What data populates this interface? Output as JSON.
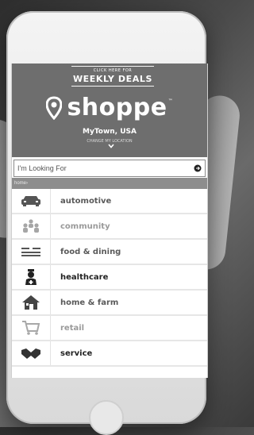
{
  "header": {
    "deals_small": "CLICK HERE FOR",
    "deals_big": "WEEKLY DEALS",
    "brand": "shoppe",
    "tm": "™",
    "town": "MyTown, USA",
    "change_town": "CHANGE MY LOCATION"
  },
  "search": {
    "placeholder": "I'm Looking For"
  },
  "breadcrumb": "home›",
  "categories": [
    {
      "label": "automotive",
      "icon": "car-icon"
    },
    {
      "label": "community",
      "icon": "people-icon"
    },
    {
      "label": "food & dining",
      "icon": "dining-icon"
    },
    {
      "label": "healthcare",
      "icon": "doctor-icon"
    },
    {
      "label": "home & farm",
      "icon": "house-icon"
    },
    {
      "label": "retail",
      "icon": "cart-icon"
    },
    {
      "label": "service",
      "icon": "handshake-icon"
    }
  ],
  "colors": {
    "header_bg": "#6e6e6e",
    "breadcrumb_bg": "#8d8d8d"
  }
}
